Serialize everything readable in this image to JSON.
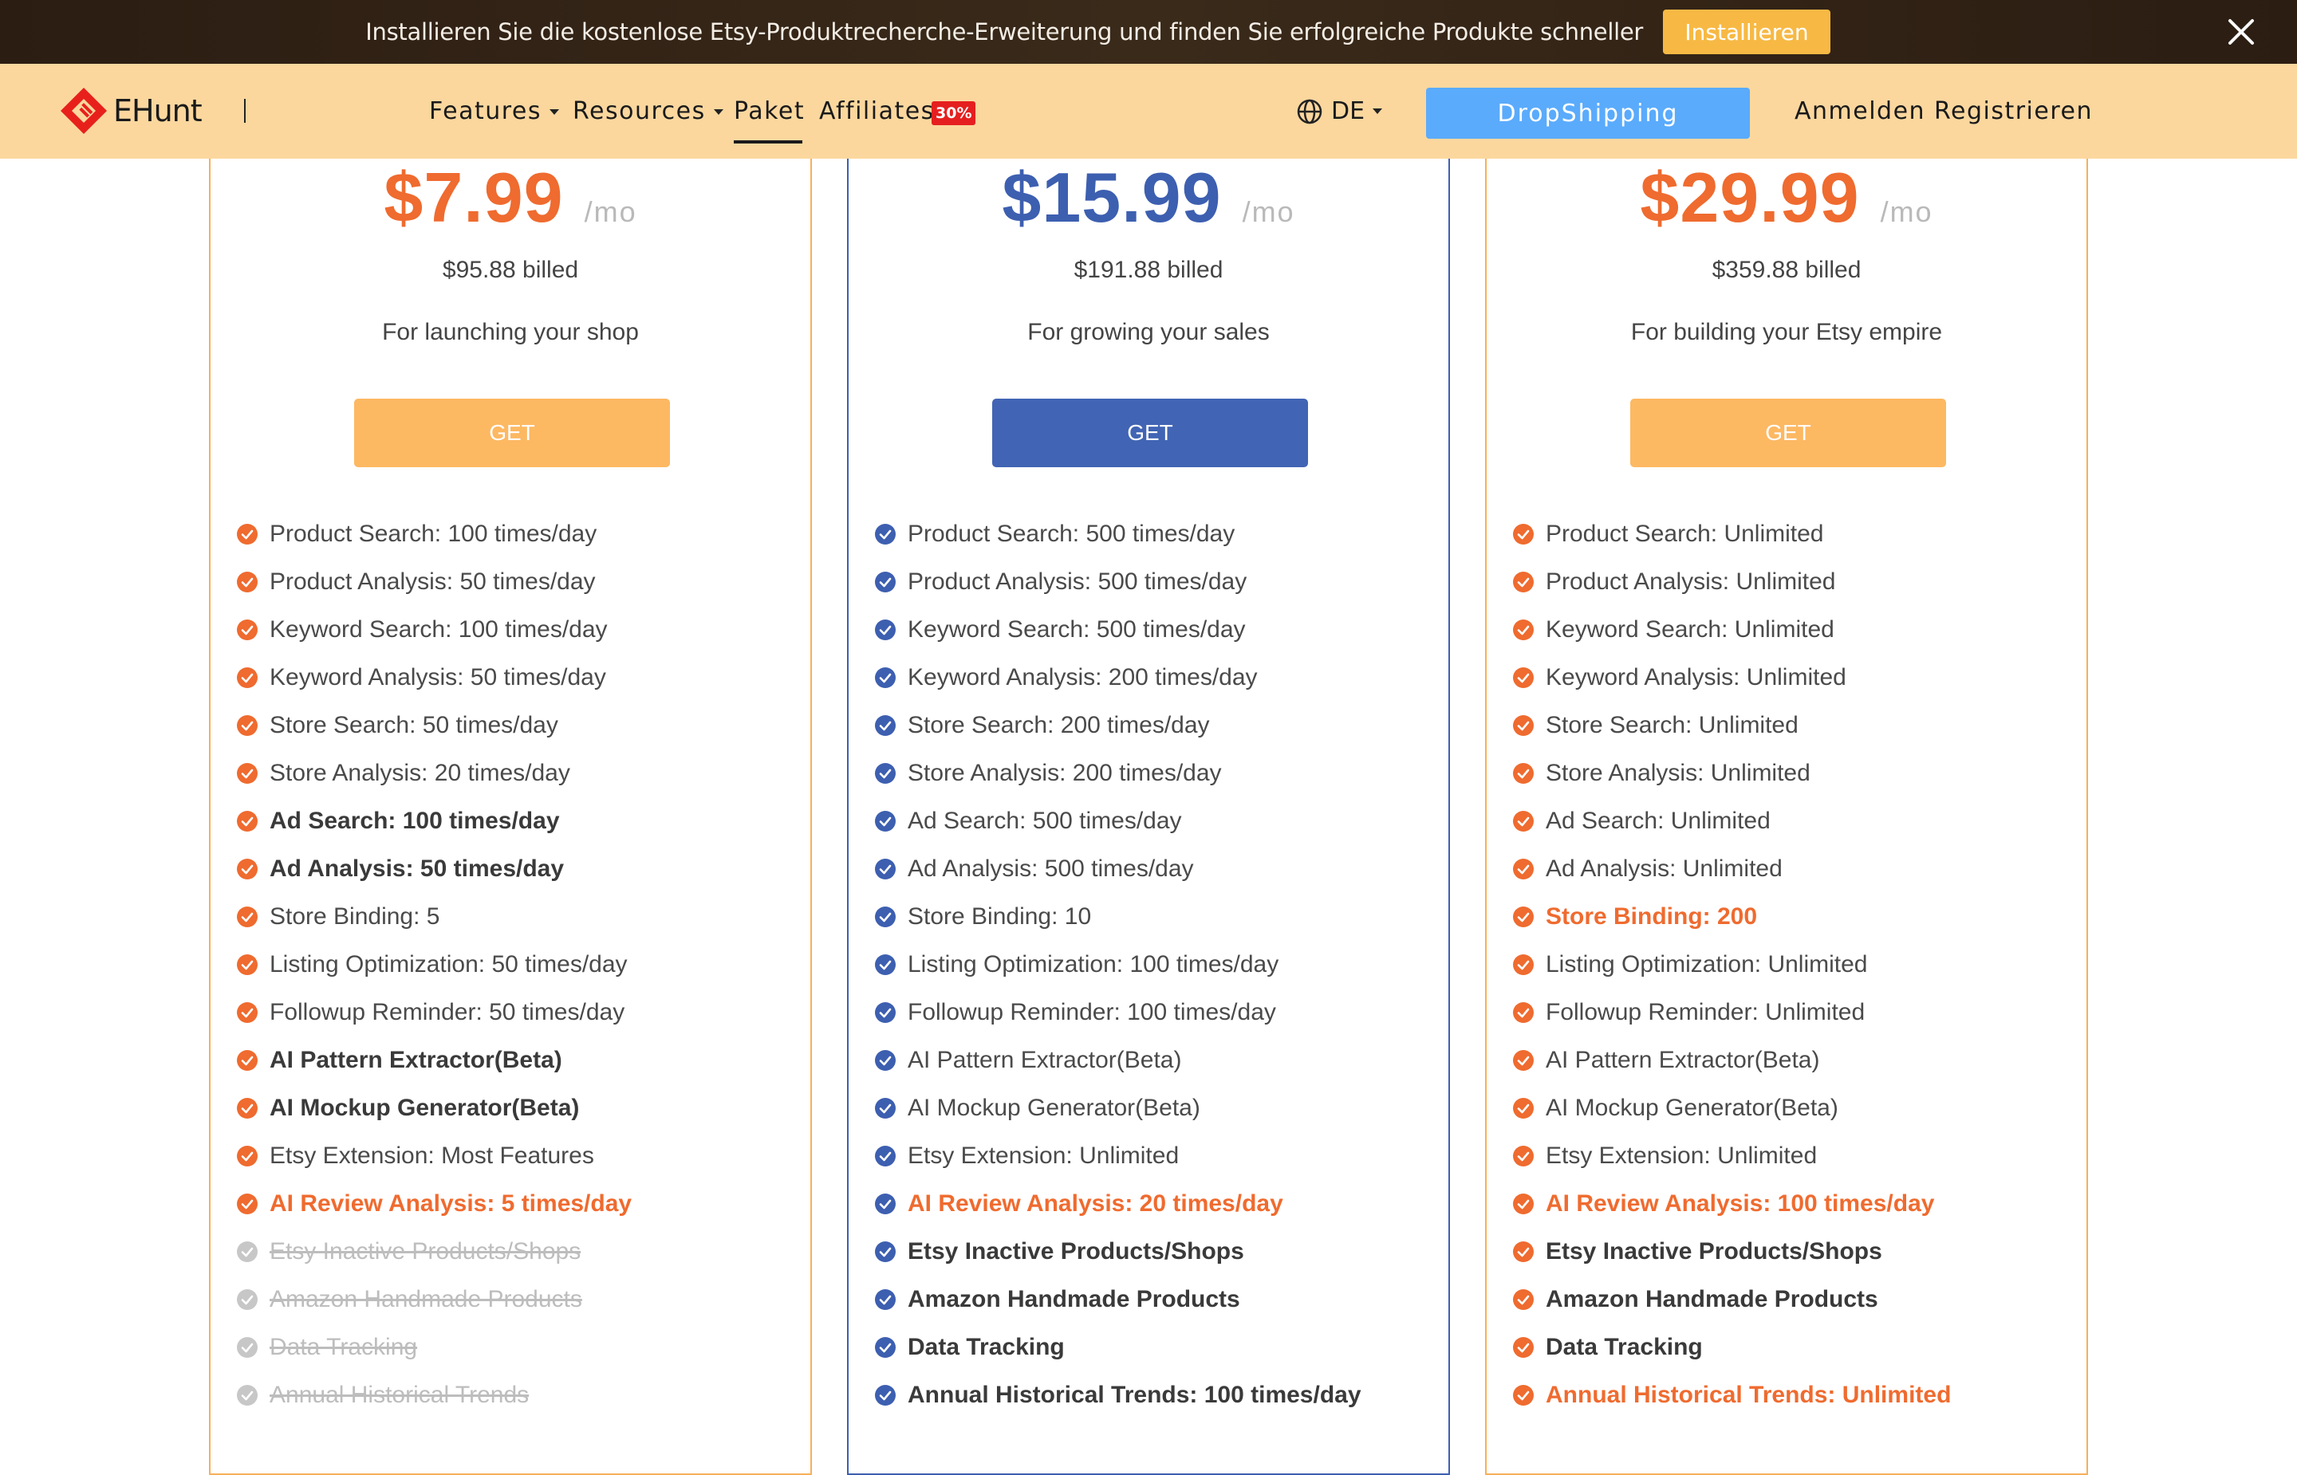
{
  "banner": {
    "text": "Installieren Sie die kostenlose Etsy-Produktrecherche-Erweiterung und finden Sie erfolgreiche Produkte schneller",
    "install_label": "Installieren"
  },
  "nav": {
    "logo_text": "EHunt",
    "features": "Features",
    "resources": "Resources",
    "paket": "Paket",
    "affiliates": "Affiliates",
    "affiliates_badge": "30%",
    "language": "DE",
    "dropshipping": "DropShipping",
    "login": "Anmelden",
    "register": "Registrieren"
  },
  "colors": {
    "orange": "#ef6b2f",
    "blue": "#3d5fb0",
    "orange_button": "#fdb862",
    "blue_button": "#4164b4",
    "disabled": "#c7c7c7"
  },
  "plans": [
    {
      "price": "$7.99",
      "per": "/mo",
      "billed": "$95.88 billed",
      "description": "For launching your shop",
      "cta": "GET",
      "features": [
        {
          "text": "Product Search: 100 times/day",
          "style": "normal"
        },
        {
          "text": "Product Analysis: 50 times/day",
          "style": "normal"
        },
        {
          "text": "Keyword Search: 100 times/day",
          "style": "normal"
        },
        {
          "text": "Keyword Analysis: 50 times/day",
          "style": "normal"
        },
        {
          "text": "Store Search: 50 times/day",
          "style": "normal"
        },
        {
          "text": "Store Analysis: 20 times/day",
          "style": "normal"
        },
        {
          "text": "Ad Search: 100 times/day",
          "style": "bold"
        },
        {
          "text": "Ad Analysis: 50 times/day",
          "style": "bold"
        },
        {
          "text": "Store Binding: 5",
          "style": "normal"
        },
        {
          "text": "Listing Optimization: 50 times/day",
          "style": "normal"
        },
        {
          "text": "Followup Reminder: 50 times/day",
          "style": "normal"
        },
        {
          "text": "AI Pattern Extractor(Beta)",
          "style": "bold"
        },
        {
          "text": "AI Mockup Generator(Beta)",
          "style": "bold"
        },
        {
          "text": "Etsy Extension: Most Features",
          "style": "normal"
        },
        {
          "text": "AI Review Analysis: 5 times/day",
          "style": "highlight"
        },
        {
          "text": "Etsy Inactive Products/Shops",
          "style": "disabled"
        },
        {
          "text": "Amazon Handmade Products",
          "style": "disabled"
        },
        {
          "text": "Data Tracking",
          "style": "disabled"
        },
        {
          "text": "Annual Historical Trends",
          "style": "disabled"
        }
      ]
    },
    {
      "price": "$15.99",
      "per": "/mo",
      "billed": "$191.88 billed",
      "description": "For growing your sales",
      "cta": "GET",
      "features": [
        {
          "text": "Product Search: 500 times/day",
          "style": "normal"
        },
        {
          "text": "Product Analysis: 500 times/day",
          "style": "normal"
        },
        {
          "text": "Keyword Search: 500 times/day",
          "style": "normal"
        },
        {
          "text": "Keyword Analysis: 200 times/day",
          "style": "normal"
        },
        {
          "text": "Store Search: 200 times/day",
          "style": "normal"
        },
        {
          "text": "Store Analysis: 200 times/day",
          "style": "normal"
        },
        {
          "text": "Ad Search: 500 times/day",
          "style": "normal"
        },
        {
          "text": "Ad Analysis: 500 times/day",
          "style": "normal"
        },
        {
          "text": "Store Binding: 10",
          "style": "normal"
        },
        {
          "text": "Listing Optimization: 100 times/day",
          "style": "normal"
        },
        {
          "text": "Followup Reminder: 100 times/day",
          "style": "normal"
        },
        {
          "text": "AI Pattern Extractor(Beta)",
          "style": "normal"
        },
        {
          "text": "AI Mockup Generator(Beta)",
          "style": "normal"
        },
        {
          "text": "Etsy Extension: Unlimited",
          "style": "normal"
        },
        {
          "text": "AI Review Analysis: 20 times/day",
          "style": "highlight"
        },
        {
          "text": "Etsy Inactive Products/Shops",
          "style": "bold"
        },
        {
          "text": "Amazon Handmade Products",
          "style": "bold"
        },
        {
          "text": "Data Tracking",
          "style": "bold"
        },
        {
          "text": "Annual Historical Trends: 100 times/day",
          "style": "bold"
        }
      ]
    },
    {
      "price": "$29.99",
      "per": "/mo",
      "billed": "$359.88 billed",
      "description": "For building your Etsy empire",
      "cta": "GET",
      "features": [
        {
          "text": "Product Search: Unlimited",
          "style": "normal"
        },
        {
          "text": "Product Analysis: Unlimited",
          "style": "normal"
        },
        {
          "text": "Keyword Search: Unlimited",
          "style": "normal"
        },
        {
          "text": "Keyword Analysis: Unlimited",
          "style": "normal"
        },
        {
          "text": "Store Search: Unlimited",
          "style": "normal"
        },
        {
          "text": "Store Analysis: Unlimited",
          "style": "normal"
        },
        {
          "text": "Ad Search: Unlimited",
          "style": "normal"
        },
        {
          "text": "Ad Analysis: Unlimited",
          "style": "normal"
        },
        {
          "text": "Store Binding: 200",
          "style": "highlight"
        },
        {
          "text": "Listing Optimization: Unlimited",
          "style": "normal"
        },
        {
          "text": "Followup Reminder: Unlimited",
          "style": "normal"
        },
        {
          "text": "AI Pattern Extractor(Beta)",
          "style": "normal"
        },
        {
          "text": "AI Mockup Generator(Beta)",
          "style": "normal"
        },
        {
          "text": "Etsy Extension: Unlimited",
          "style": "normal"
        },
        {
          "text": "AI Review Analysis: 100 times/day",
          "style": "highlight"
        },
        {
          "text": "Etsy Inactive Products/Shops",
          "style": "bold"
        },
        {
          "text": "Amazon Handmade Products",
          "style": "bold"
        },
        {
          "text": "Data Tracking",
          "style": "bold"
        },
        {
          "text": "Annual Historical Trends: Unlimited",
          "style": "highlight"
        }
      ]
    }
  ]
}
